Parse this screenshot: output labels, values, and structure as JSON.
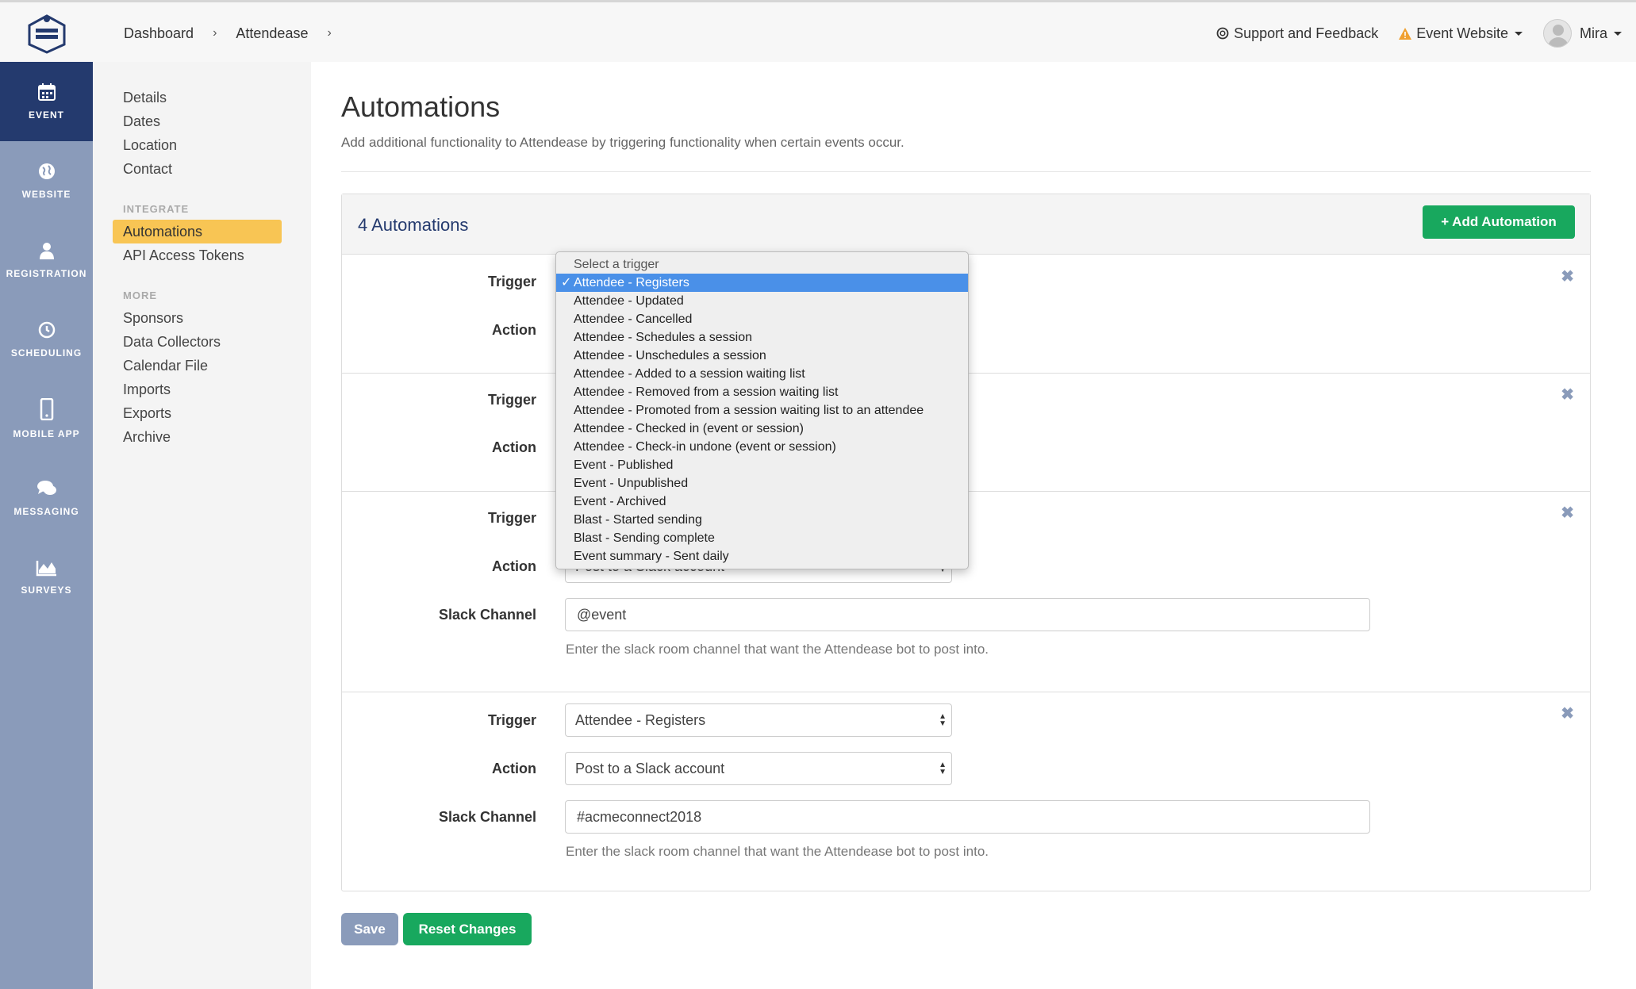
{
  "topbar": {
    "breadcrumb": [
      "Dashboard",
      "Attendease"
    ],
    "support_label": "Support and Feedback",
    "event_website_label": "Event Website",
    "user_name": "Mira"
  },
  "leftnav": [
    {
      "label": "EVENT",
      "icon": "calendar-icon",
      "active": true
    },
    {
      "label": "WEBSITE",
      "icon": "globe-icon"
    },
    {
      "label": "REGISTRATION",
      "icon": "user-icon"
    },
    {
      "label": "SCHEDULING",
      "icon": "clock-icon"
    },
    {
      "label": "MOBILE APP",
      "icon": "phone-icon"
    },
    {
      "label": "MESSAGING",
      "icon": "chat-icon"
    },
    {
      "label": "SURVEYS",
      "icon": "chart-icon"
    }
  ],
  "subnav": {
    "top_links": [
      "Details",
      "Dates",
      "Location",
      "Contact"
    ],
    "integrate_heading": "INTEGRATE",
    "integrate_links": [
      "Automations",
      "API Access Tokens"
    ],
    "more_heading": "MORE",
    "more_links": [
      "Sponsors",
      "Data Collectors",
      "Calendar File",
      "Imports",
      "Exports",
      "Archive"
    ]
  },
  "page": {
    "title": "Automations",
    "subtitle": "Add additional functionality to Attendease by triggering functionality when certain events occur."
  },
  "panel": {
    "title": "4 Automations",
    "add_button": "Add Automation"
  },
  "labels": {
    "trigger": "Trigger",
    "action": "Action",
    "slack_channel": "Slack Channel"
  },
  "automations": [
    {
      "trigger": "",
      "action": ""
    },
    {
      "trigger": "",
      "action": ""
    },
    {
      "trigger": "",
      "action": "Post to a Slack account",
      "slack_channel": "@event",
      "help": "Enter the slack room channel that want the Attendease bot to post into."
    },
    {
      "trigger": "Attendee - Registers",
      "action": "Post to a Slack account",
      "slack_channel": "#acmeconnect2018",
      "help": "Enter the slack room channel that want the Attendease bot to post into."
    }
  ],
  "dropdown": {
    "placeholder": "Select a trigger",
    "selected": "Attendee - Registers",
    "options": [
      "Attendee - Registers",
      "Attendee - Updated",
      "Attendee - Cancelled",
      "Attendee - Schedules a session",
      "Attendee - Unschedules a session",
      "Attendee - Added to a session waiting list",
      "Attendee - Removed from a session waiting list",
      "Attendee - Promoted from a session waiting list to an attendee",
      "Attendee - Checked in (event or session)",
      "Attendee - Check-in undone (event or session)",
      "Event - Published",
      "Event - Unpublished",
      "Event - Archived",
      "Blast - Started sending",
      "Blast - Sending complete",
      "Event summary - Sent daily"
    ]
  },
  "footer": {
    "save": "Save",
    "reset": "Reset Changes"
  },
  "colors": {
    "nav_bg": "#8a9bba",
    "nav_active": "#243a6e",
    "accent_green": "#18a85e",
    "highlight_yellow": "#f8c554",
    "dropdown_selected": "#4a90e8"
  }
}
